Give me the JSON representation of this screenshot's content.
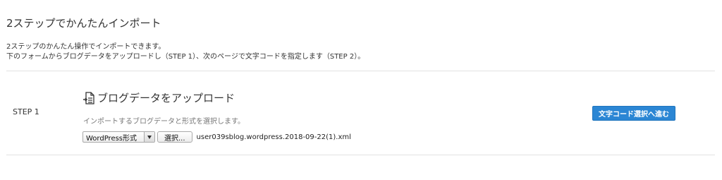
{
  "page": {
    "title": "2ステップでかんたんインポート",
    "intro_line1": "2ステップのかんたん操作でインポートできます。",
    "intro_line2": "下のフォームからブログデータをアップロードし（STEP 1）、次のページで文字コードを指定します（STEP 2）。"
  },
  "step": {
    "label": "STEP 1",
    "icon": "document-import-icon",
    "title": "ブログデータをアップロード",
    "description": "インポートするブログデータと形式を選択します。",
    "format_select": {
      "selected": "WordPress形式"
    },
    "file_button_label": "選択...",
    "file_name": "user039sblog.wordpress.2018-09-22(1).xml",
    "next_button_label": "文字コード選択へ進む"
  },
  "colors": {
    "accent": "#2b86d4",
    "divider": "#e2e2e2"
  }
}
